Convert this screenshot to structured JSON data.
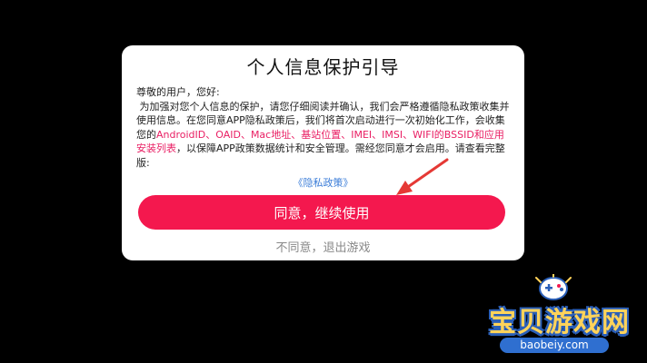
{
  "dialog": {
    "title": "个人信息保护引导",
    "greeting": "尊敬的用户，您好:",
    "body_part1": "为加强对您个人信息的保护，请您仔细阅读并确认，我们会严格遵循隐私政策收集并使用信息。在您同意APP隐私政策后，我们将首次启动进行一次初始化工作，会收集您的",
    "body_highlight": "AndroidID、OAID、Mac地址、基站位置、IMEI、IMSI、WIFI的BSSID和应用安装列表",
    "body_part2": "，以保障APP政策数据统计和安全管理。需经您同意才会启用。请查看完整版:",
    "policy_link": "《隐私政策》",
    "agree_button": "同意，继续使用",
    "decline_button": "不同意，退出游戏"
  },
  "watermark": {
    "title": "宝贝游戏网",
    "url": "baobeiy.com"
  },
  "colors": {
    "accent": "#f4184e",
    "highlight": "#e91e63",
    "link": "#3b7dd8"
  }
}
